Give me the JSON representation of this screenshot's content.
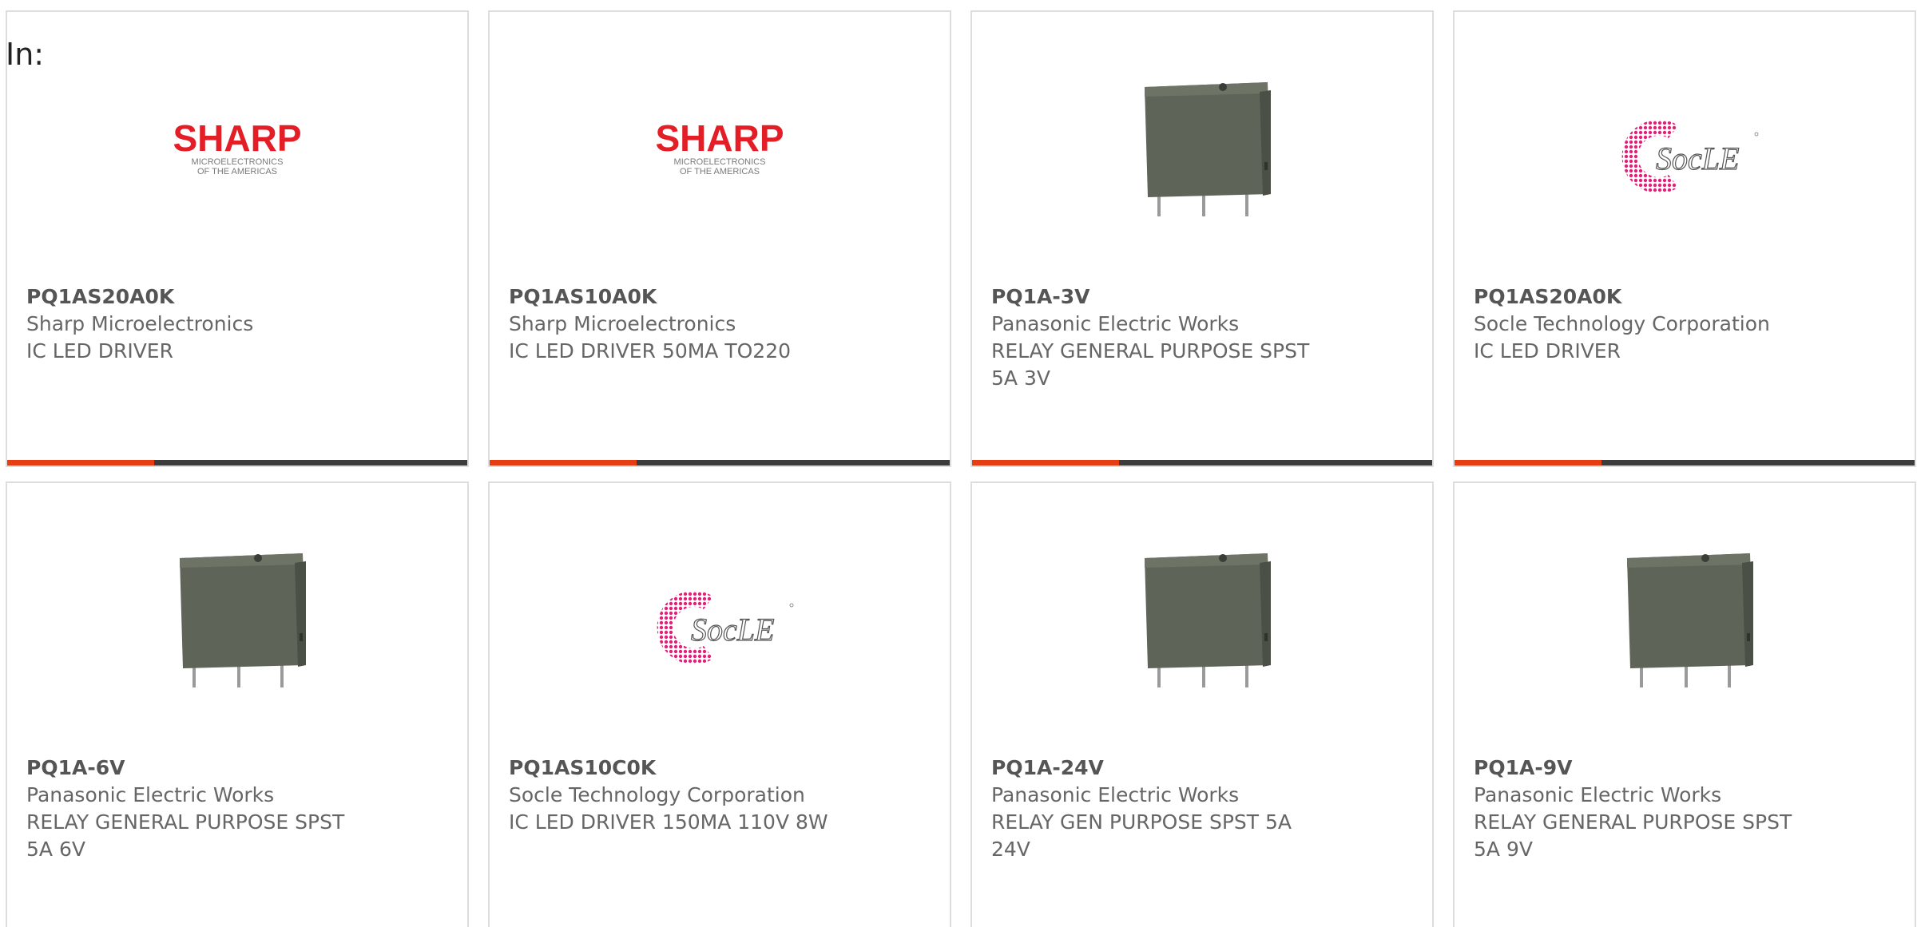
{
  "header": {
    "in_label": "In:"
  },
  "colors": {
    "accent": "#e43d12",
    "bar_dark": "#3c3c3c",
    "card_border": "#dddddd",
    "text": "#666666"
  },
  "logos": {
    "sharp_word": "SHARP",
    "sharp_sub1": "MICROELECTRONICS",
    "sharp_sub2": "OF THE AMERICAS",
    "socle_word": "SocLE"
  },
  "products": [
    {
      "part": "PQ1AS20A0K",
      "manufacturer": "Sharp Microelectronics",
      "description_line1": "IC LED DRIVER",
      "description_line2": "",
      "image": "sharp-logo",
      "progress": 0.32
    },
    {
      "part": "PQ1AS10A0K",
      "manufacturer": "Sharp Microelectronics",
      "description_line1": "IC LED DRIVER 50MA TO220",
      "description_line2": "",
      "image": "sharp-logo",
      "progress": 0.32
    },
    {
      "part": "PQ1A-3V",
      "manufacturer": "Panasonic Electric Works",
      "description_line1": "RELAY GENERAL PURPOSE SPST",
      "description_line2": "5A 3V",
      "image": "relay-photo",
      "progress": 0.32
    },
    {
      "part": "PQ1AS20A0K",
      "manufacturer": "Socle Technology Corporation",
      "description_line1": "IC LED DRIVER",
      "description_line2": "",
      "image": "socle-logo",
      "progress": 0.32
    },
    {
      "part": "PQ1A-6V",
      "manufacturer": "Panasonic Electric Works",
      "description_line1": "RELAY GENERAL PURPOSE SPST",
      "description_line2": "5A 6V",
      "image": "relay-photo",
      "progress": 0.32
    },
    {
      "part": "PQ1AS10C0K",
      "manufacturer": "Socle Technology Corporation",
      "description_line1": "IC LED DRIVER 150MA 110V 8W",
      "description_line2": "",
      "image": "socle-logo",
      "progress": 0.32
    },
    {
      "part": "PQ1A-24V",
      "manufacturer": "Panasonic Electric Works",
      "description_line1": "RELAY GEN PURPOSE SPST 5A",
      "description_line2": "24V",
      "image": "relay-photo",
      "progress": 0.32
    },
    {
      "part": "PQ1A-9V",
      "manufacturer": "Panasonic Electric Works",
      "description_line1": "RELAY GENERAL PURPOSE SPST",
      "description_line2": "5A 9V",
      "image": "relay-photo",
      "progress": 0.32
    }
  ]
}
